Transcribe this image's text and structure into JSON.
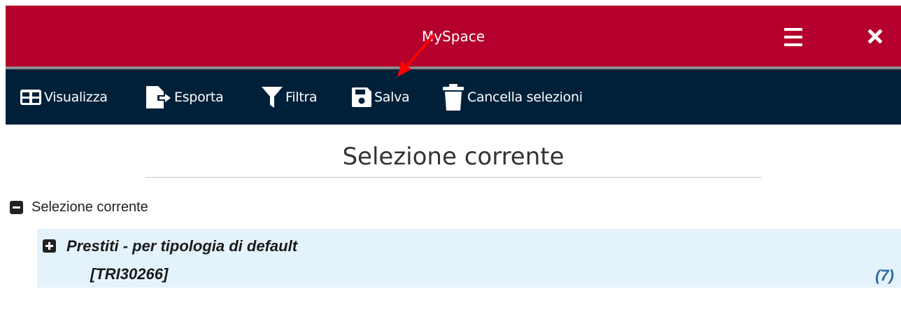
{
  "header": {
    "title": "MySpace",
    "menu_icon": "hamburger-menu-icon",
    "close_icon": "close-icon",
    "color": "#b5002d"
  },
  "toolbar": {
    "color": "#00203a",
    "items": [
      {
        "label": "Visualizza",
        "icon": "table-view-icon"
      },
      {
        "label": "Esporta",
        "icon": "export-file-icon"
      },
      {
        "label": "Filtra",
        "icon": "filter-icon"
      },
      {
        "label": "Salva",
        "icon": "floppy-save-icon"
      },
      {
        "label": "Cancella selezioni",
        "icon": "trash-icon"
      }
    ]
  },
  "annotation": {
    "icon": "red-arrow-icon",
    "color": "#ff0000"
  },
  "main": {
    "heading": "Selezione corrente",
    "tree": {
      "root_label": "Selezione corrente",
      "root_icon": "collapse-minus-icon",
      "items": [
        {
          "name": "Prestiti - per tipologia di default",
          "code": "[TRI30266]",
          "count": "(7)",
          "icon": "expand-plus-icon"
        }
      ]
    }
  }
}
